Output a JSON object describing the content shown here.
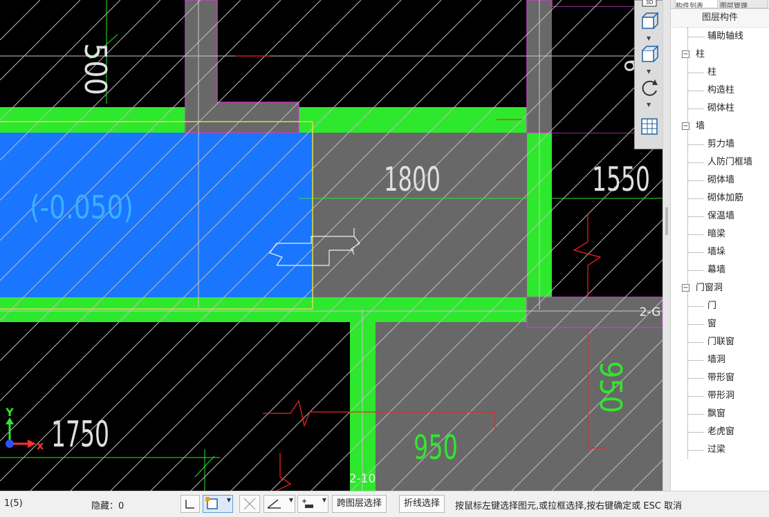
{
  "canvas": {
    "dimensions": {
      "d500": "500",
      "d1800": "1800",
      "d1550": "1550",
      "d1750": "1750",
      "d950_h": "950",
      "d950_v": "950"
    },
    "elevation": "(-0.050)",
    "axis_labels": {
      "ax_2g": "2-G",
      "ax_210": "2-10",
      "ax_partial": "6"
    },
    "coord_axes": {
      "y": "Y",
      "x": "x"
    },
    "colors": {
      "background": "#000000",
      "slab_blue": "#1a75ff",
      "wall_green": "#2ee82e",
      "room_gray": "#686868",
      "column_outline": "#c040c0",
      "axis_line": "#cccccc",
      "break_line": "#ff2020",
      "dim_text": "#e0e0e0",
      "elev_text": "#39b0ff"
    }
  },
  "toolbar3d": {
    "buttons": [
      "3d-icon",
      "cube-view-icon",
      "cube-side-icon",
      "rotate-icon",
      "layer-grid-icon"
    ]
  },
  "panel": {
    "tab1": "构件列表",
    "tab2": "图层管理",
    "header": "图层构件",
    "items": [
      {
        "label": "辅助轴线",
        "type": "child"
      },
      {
        "label": "柱",
        "type": "group",
        "sign": "−"
      },
      {
        "label": "柱",
        "type": "child"
      },
      {
        "label": "构造柱",
        "type": "child"
      },
      {
        "label": "砌体柱",
        "type": "child"
      },
      {
        "label": "墙",
        "type": "group",
        "sign": "−"
      },
      {
        "label": "剪力墙",
        "type": "child"
      },
      {
        "label": "人防门框墙",
        "type": "child"
      },
      {
        "label": "砌体墙",
        "type": "child"
      },
      {
        "label": "砌体加筋",
        "type": "child"
      },
      {
        "label": "保温墙",
        "type": "child"
      },
      {
        "label": "暗梁",
        "type": "child"
      },
      {
        "label": "墙垛",
        "type": "child"
      },
      {
        "label": "幕墙",
        "type": "child"
      },
      {
        "label": "门窗洞",
        "type": "group",
        "sign": "−"
      },
      {
        "label": "门",
        "type": "child"
      },
      {
        "label": "窗",
        "type": "child"
      },
      {
        "label": "门联窗",
        "type": "child"
      },
      {
        "label": "墙洞",
        "type": "child"
      },
      {
        "label": "带形窗",
        "type": "child"
      },
      {
        "label": "带形洞",
        "type": "child"
      },
      {
        "label": "飘窗",
        "type": "child"
      },
      {
        "label": "老虎窗",
        "type": "child"
      },
      {
        "label": "过梁",
        "type": "child"
      }
    ]
  },
  "status": {
    "selection_count": "1(5)",
    "hidden_label": "隐藏：0",
    "cross_layer_select": "跨图层选择",
    "polyline_select": "折线选择",
    "hint": "按鼠标左键选择图元,或拉框选择,按右键确定或 ESC 取消"
  }
}
